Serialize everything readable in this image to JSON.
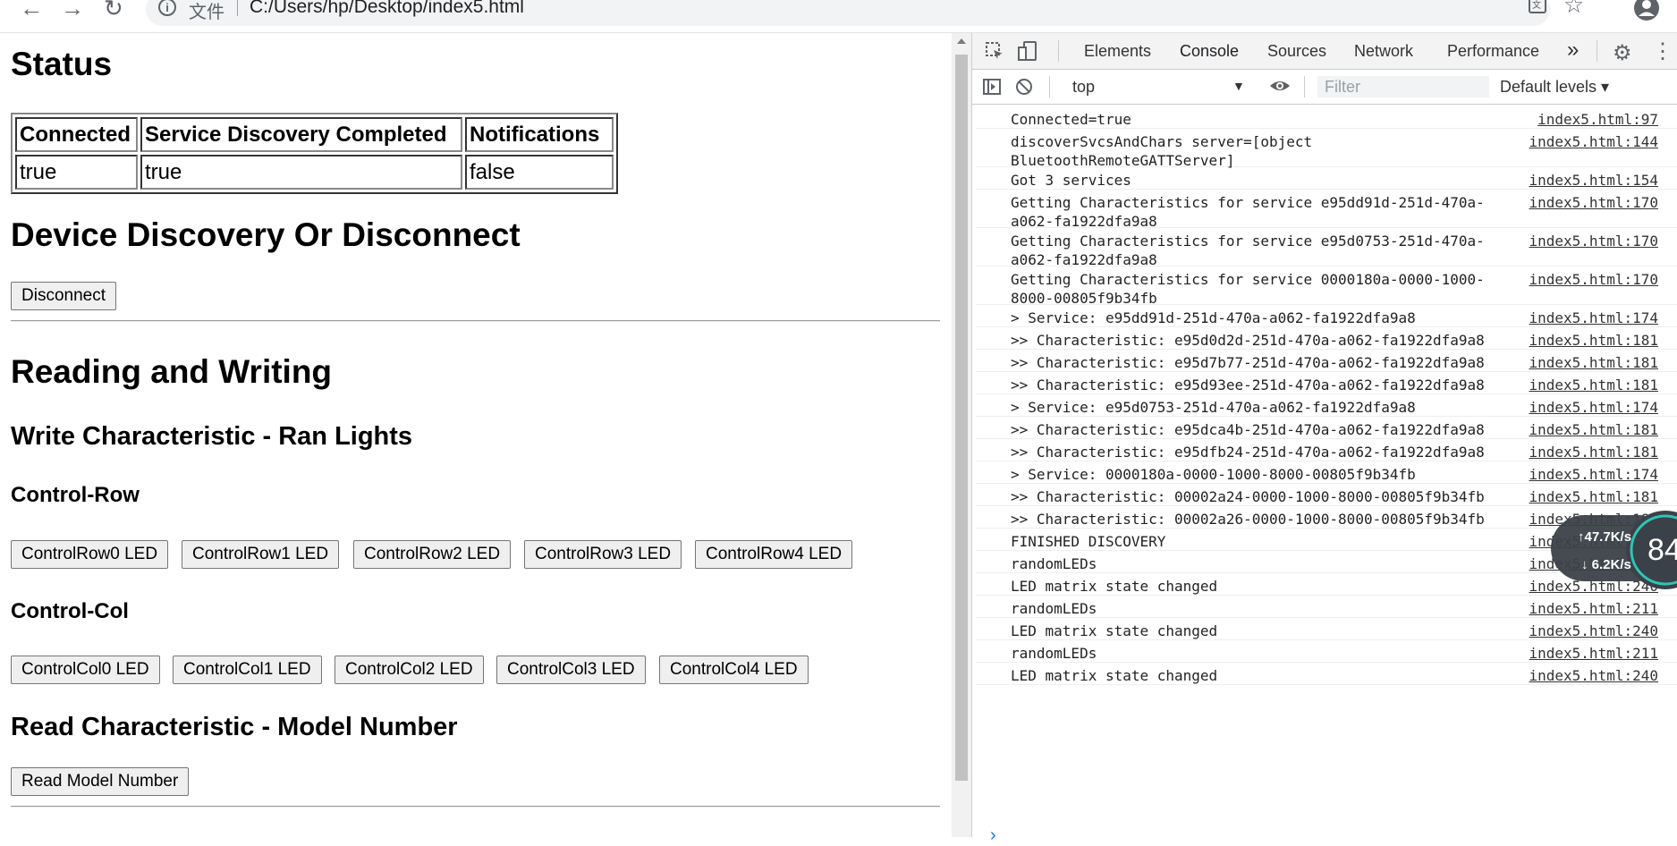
{
  "browser": {
    "back_glyph": "←",
    "forward_glyph": "→",
    "reload_glyph": "↻",
    "security_chip": "文件",
    "url": "C:/Users/hp/Desktop/index5.html"
  },
  "page": {
    "status_heading": "Status",
    "status_table": {
      "headers": [
        "Connected",
        "Service Discovery Completed",
        "Notifications"
      ],
      "values": [
        "true",
        "true",
        "false"
      ]
    },
    "discovery_heading": "Device Discovery Or Disconnect",
    "disconnect_label": "Disconnect",
    "rw_heading": "Reading and Writing",
    "write_heading": "Write Characteristic - Ran Lights",
    "control_row_heading": "Control-Row",
    "row_buttons": [
      "ControlRow0 LED",
      "ControlRow1 LED",
      "ControlRow2 LED",
      "ControlRow3 LED",
      "ControlRow4 LED"
    ],
    "control_col_heading": "Control-Col",
    "col_buttons": [
      "ControlCol0 LED",
      "ControlCol1 LED",
      "ControlCol2 LED",
      "ControlCol3 LED",
      "ControlCol4 LED"
    ],
    "read_heading": "Read Characteristic - Model Number",
    "read_button": "Read Model Number"
  },
  "devtools": {
    "tabs": [
      "Elements",
      "Console",
      "Sources",
      "Network",
      "Performance"
    ],
    "active_tab": "Console",
    "more_tabs": "»",
    "context": "top",
    "filter_placeholder": "Filter",
    "levels": "Default levels ▾",
    "accent_color": "#1a73e8",
    "messages": [
      {
        "text": "Connected=true",
        "src": "index5.html:97"
      },
      {
        "text": "discoverSvcsAndChars server=[object\nBluetoothRemoteGATTServer]",
        "src": "index5.html:144"
      },
      {
        "text": "Got 3 services",
        "src": "index5.html:154"
      },
      {
        "text": "Getting Characteristics for service e95dd91d-251d-470a-\na062-fa1922dfa9a8",
        "src": "index5.html:170"
      },
      {
        "text": "Getting Characteristics for service e95d0753-251d-470a-\na062-fa1922dfa9a8",
        "src": "index5.html:170"
      },
      {
        "text": "Getting Characteristics for service 0000180a-0000-1000-\n8000-00805f9b34fb",
        "src": "index5.html:170"
      },
      {
        "text": "> Service: e95dd91d-251d-470a-a062-fa1922dfa9a8",
        "src": "index5.html:174"
      },
      {
        "text": ">> Characteristic: e95d0d2d-251d-470a-a062-fa1922dfa9a8",
        "src": "index5.html:181"
      },
      {
        "text": ">> Characteristic: e95d7b77-251d-470a-a062-fa1922dfa9a8",
        "src": "index5.html:181"
      },
      {
        "text": ">> Characteristic: e95d93ee-251d-470a-a062-fa1922dfa9a8",
        "src": "index5.html:181"
      },
      {
        "text": "> Service: e95d0753-251d-470a-a062-fa1922dfa9a8",
        "src": "index5.html:174"
      },
      {
        "text": ">> Characteristic: e95dca4b-251d-470a-a062-fa1922dfa9a8",
        "src": "index5.html:181"
      },
      {
        "text": ">> Characteristic: e95dfb24-251d-470a-a062-fa1922dfa9a8",
        "src": "index5.html:181"
      },
      {
        "text": "> Service: 0000180a-0000-1000-8000-00805f9b34fb",
        "src": "index5.html:174"
      },
      {
        "text": ">> Characteristic: 00002a24-0000-1000-8000-00805f9b34fb",
        "src": "index5.html:181"
      },
      {
        "text": ">> Characteristic: 00002a26-0000-1000-8000-00805f9b34fb",
        "src": "index5.html:181"
      },
      {
        "text": "FINISHED DISCOVERY",
        "src": "index5.html:199"
      },
      {
        "text": "randomLEDs",
        "src": "index5.html:211"
      },
      {
        "text": "LED matrix state changed",
        "src": "index5.html:240"
      },
      {
        "text": "randomLEDs",
        "src": "index5.html:211"
      },
      {
        "text": "LED matrix state changed",
        "src": "index5.html:240"
      },
      {
        "text": "randomLEDs",
        "src": "index5.html:211"
      },
      {
        "text": "LED matrix state changed",
        "src": "index5.html:240"
      }
    ],
    "prompt": "›"
  },
  "network_widget": {
    "upload": "↑47.7K/s",
    "download": "↓ 6.2K/s",
    "percent": "84"
  }
}
